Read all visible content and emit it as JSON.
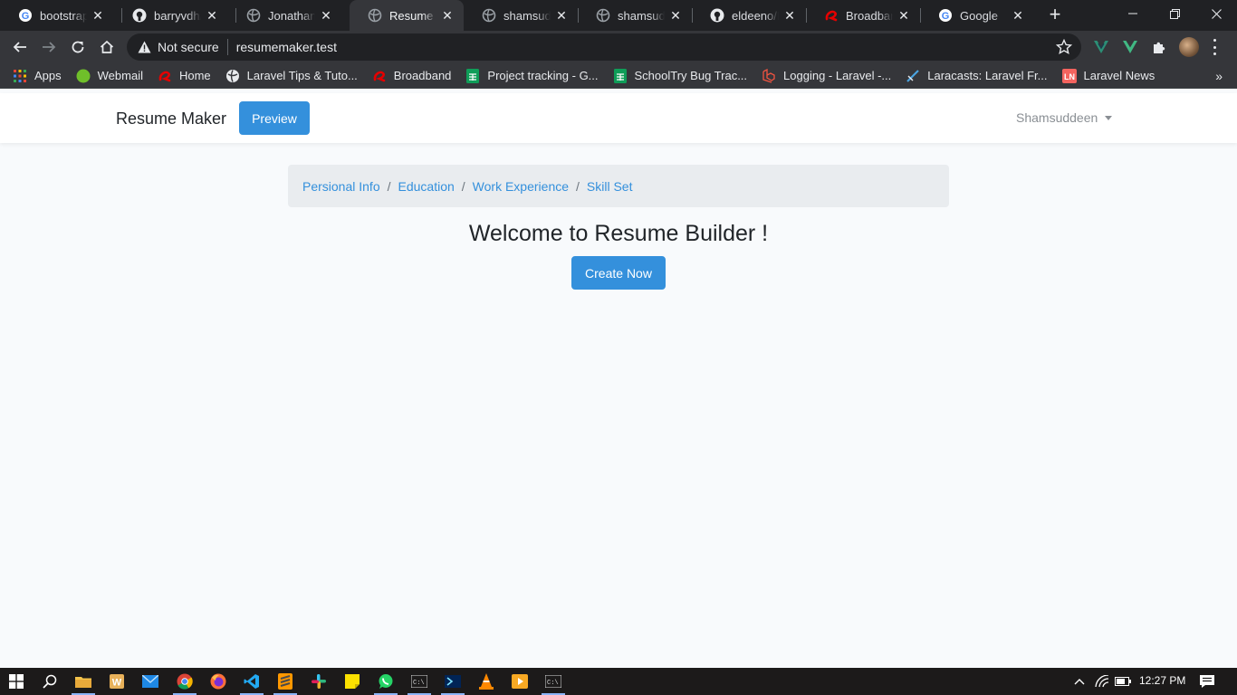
{
  "browser": {
    "tabs": [
      {
        "title": "bootstrap n",
        "icon": "google-icon",
        "active": false
      },
      {
        "title": "barryvdh/la",
        "icon": "github-icon",
        "active": false
      },
      {
        "title": "Jonathan D",
        "icon": "globe-icon",
        "active": false
      },
      {
        "title": "Resume Ma",
        "icon": "globe-icon",
        "active": true
      },
      {
        "title": "shamsudde",
        "icon": "globe-icon",
        "active": false
      },
      {
        "title": "shamsudde",
        "icon": "globe-icon",
        "active": false
      },
      {
        "title": "eldeeno/Re",
        "icon": "github-icon",
        "active": false
      },
      {
        "title": "Broadband",
        "icon": "airtel-icon",
        "active": false
      },
      {
        "title": "Google",
        "icon": "google-icon",
        "active": false
      }
    ],
    "omnibox": {
      "security_label": "Not secure",
      "url": "resumemaker.test"
    },
    "bookmarks": [
      {
        "label": "Apps",
        "icon": "apps-grid-icon"
      },
      {
        "label": "Webmail",
        "icon": "webmail-icon"
      },
      {
        "label": "Home",
        "icon": "airtel-icon"
      },
      {
        "label": "Laravel Tips & Tuto...",
        "icon": "globe-icon"
      },
      {
        "label": "Broadband",
        "icon": "airtel-icon"
      },
      {
        "label": "Project tracking - G...",
        "icon": "sheets-icon"
      },
      {
        "label": "SchoolTry Bug Trac...",
        "icon": "sheets-icon"
      },
      {
        "label": "Logging - Laravel -...",
        "icon": "laravel-icon"
      },
      {
        "label": "Laracasts: Laravel Fr...",
        "icon": "laracasts-icon"
      },
      {
        "label": "Laravel News",
        "icon": "laravel-news-icon"
      }
    ]
  },
  "navbar": {
    "brand": "Resume Maker",
    "preview_label": "Preview",
    "user_name": "Shamsuddeen"
  },
  "breadcrumb": [
    "Persional Info",
    "Education",
    "Work Experience",
    "Skill Set"
  ],
  "main": {
    "heading": "Welcome to Resume Builder !",
    "create_label": "Create Now"
  },
  "taskbar": {
    "clock": "12:27 PM"
  },
  "colors": {
    "primary": "#3490dc",
    "page_bg": "#f8fafc",
    "breadcrumb_bg": "#e9ecef",
    "chrome_dark": "#202124",
    "chrome_toolbar": "#35363a"
  }
}
